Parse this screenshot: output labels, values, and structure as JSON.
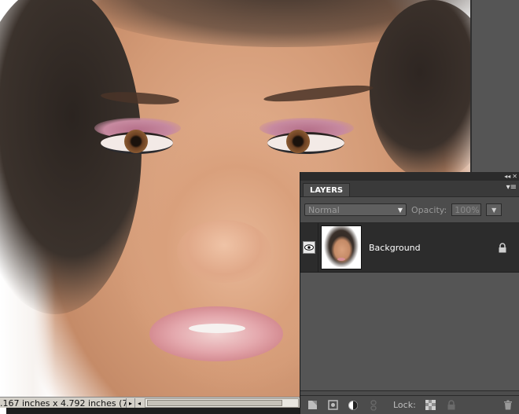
{
  "canvas": {
    "photo_name": "woman-portrait-photo"
  },
  "statusbar": {
    "doc_info": ".167 inches x 4.792 inches (7...",
    "arrow_label": "▸",
    "scroll_left_label": "◂"
  },
  "layers_panel": {
    "tab_label": "LAYERS",
    "collapse_glyph": "◂◂",
    "close_glyph": "✕",
    "menu_glyph": "▾≡",
    "blend_mode": "Normal",
    "opacity_label": "Opacity:",
    "opacity_value": "100%",
    "layers": [
      {
        "name": "Background",
        "visible": true,
        "locked": true
      }
    ],
    "footer": {
      "lock_label": "Lock:"
    }
  },
  "colors": {
    "panel_bg": "#4c4c4c",
    "layer_row_bg": "#2c2c2c",
    "workspace_gray": "#555555"
  }
}
